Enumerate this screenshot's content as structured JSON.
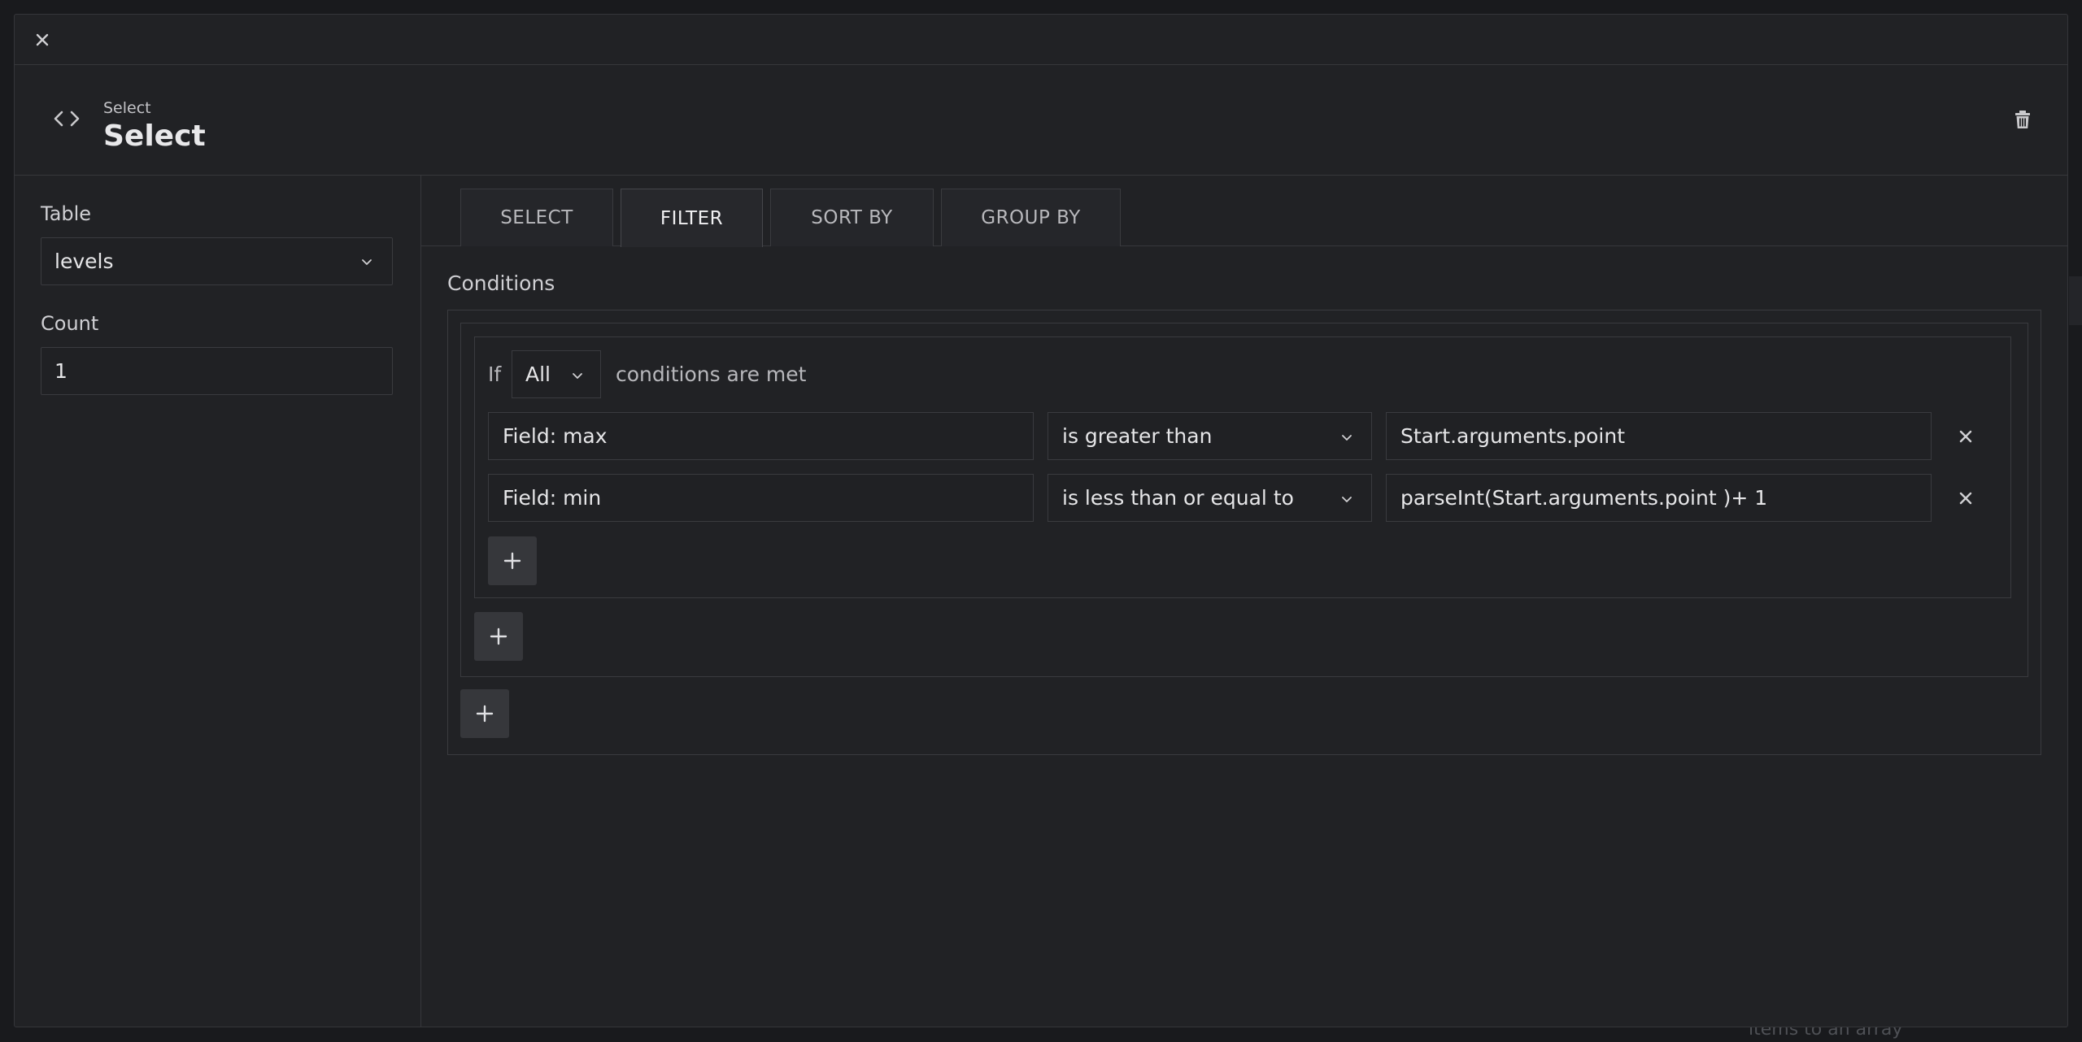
{
  "topbar": {
    "close_icon": "close-icon"
  },
  "header": {
    "subtitle": "Select",
    "title": "Select",
    "icon": "code-icon",
    "delete_icon": "trash-icon"
  },
  "left": {
    "table_label": "Table",
    "table_value": "levels",
    "count_label": "Count",
    "count_value": "1"
  },
  "tabs": [
    {
      "label": "SELECT",
      "active": false
    },
    {
      "label": "FILTER",
      "active": true
    },
    {
      "label": "SORT BY",
      "active": false
    },
    {
      "label": "GROUP BY",
      "active": false
    }
  ],
  "filter": {
    "conditions_label": "Conditions",
    "if_text": "If",
    "match_value": "All",
    "met_text": "conditions are met",
    "rows": [
      {
        "field": "Field: max",
        "operator": "is greater than",
        "value": "Start.arguments.point"
      },
      {
        "field": "Field: min",
        "operator": "is less than or equal to",
        "value": "parseInt(Start.arguments.point )+ 1"
      }
    ]
  },
  "backdrop": {
    "hint_text": "items to an array"
  },
  "colors": {
    "background": "#191a1d",
    "modal": "#212225",
    "border": "#3a3b3f",
    "button": "#36373b"
  }
}
